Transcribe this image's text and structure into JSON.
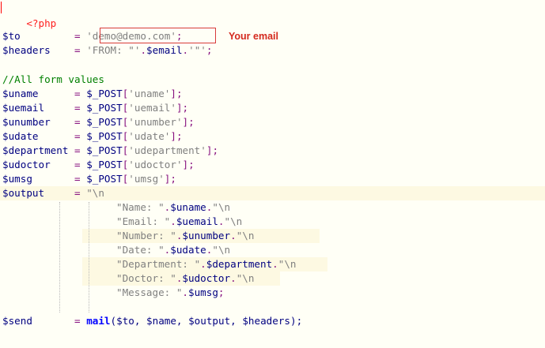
{
  "code": {
    "open_tag": "<?php",
    "to_var": "$to",
    "to_pad": "         ",
    "assign": "=",
    "to_value": "'demo@demo.com'",
    "semicolon": ";",
    "headers_var": "$headers",
    "headers_pad": "    ",
    "headers_str1": "'FROM: \"'",
    "concat": ".",
    "email_var": "$email",
    "headers_str2": "'\"'",
    "comment": "//All form values",
    "post_lines": [
      {
        "var": "$uname",
        "pad": "      ",
        "key": "'uname'"
      },
      {
        "var": "$uemail",
        "pad": "     ",
        "key": "'uemail'"
      },
      {
        "var": "$unumber",
        "pad": "    ",
        "key": "'unumber'"
      },
      {
        "var": "$udate",
        "pad": "      ",
        "key": "'udate'"
      },
      {
        "var": "$department",
        "pad": " ",
        "key": "'udepartment'"
      },
      {
        "var": "$udoctor",
        "pad": "    ",
        "key": "'udoctor'"
      },
      {
        "var": "$umsg",
        "pad": "       ",
        "key": "'umsg'"
      }
    ],
    "post_fn": "$_POST",
    "bracket_open": "[",
    "bracket_close": "]",
    "output_var": "$output",
    "output_pad": "     ",
    "output_open": "\"\\n",
    "message_lines": [
      {
        "label": "\"Name: \"",
        "var": "$uname",
        "tail": "\"\\n"
      },
      {
        "label": "\"Email: \"",
        "var": "$uemail",
        "tail": "\"\\n"
      },
      {
        "label": "\"Number: \"",
        "var": "$unumber",
        "tail": "\"\\n"
      },
      {
        "label": "\"Date: \"",
        "var": "$udate",
        "tail": "\"\\n"
      },
      {
        "label": "\"Department: \"",
        "var": "$department",
        "tail": "\"\\n"
      },
      {
        "label": "\"Doctor: \"",
        "var": "$udoctor",
        "tail": "\"\\n"
      },
      {
        "label": "\"Message: \"",
        "var": "$umsg",
        "tail": ";"
      }
    ],
    "send_var": "$send",
    "send_pad": "       ",
    "mail_fn": "mail",
    "send_args": "($to, $name, $output, $headers);"
  },
  "annotation": {
    "label": "Your email",
    "color": "#d42a1f"
  }
}
